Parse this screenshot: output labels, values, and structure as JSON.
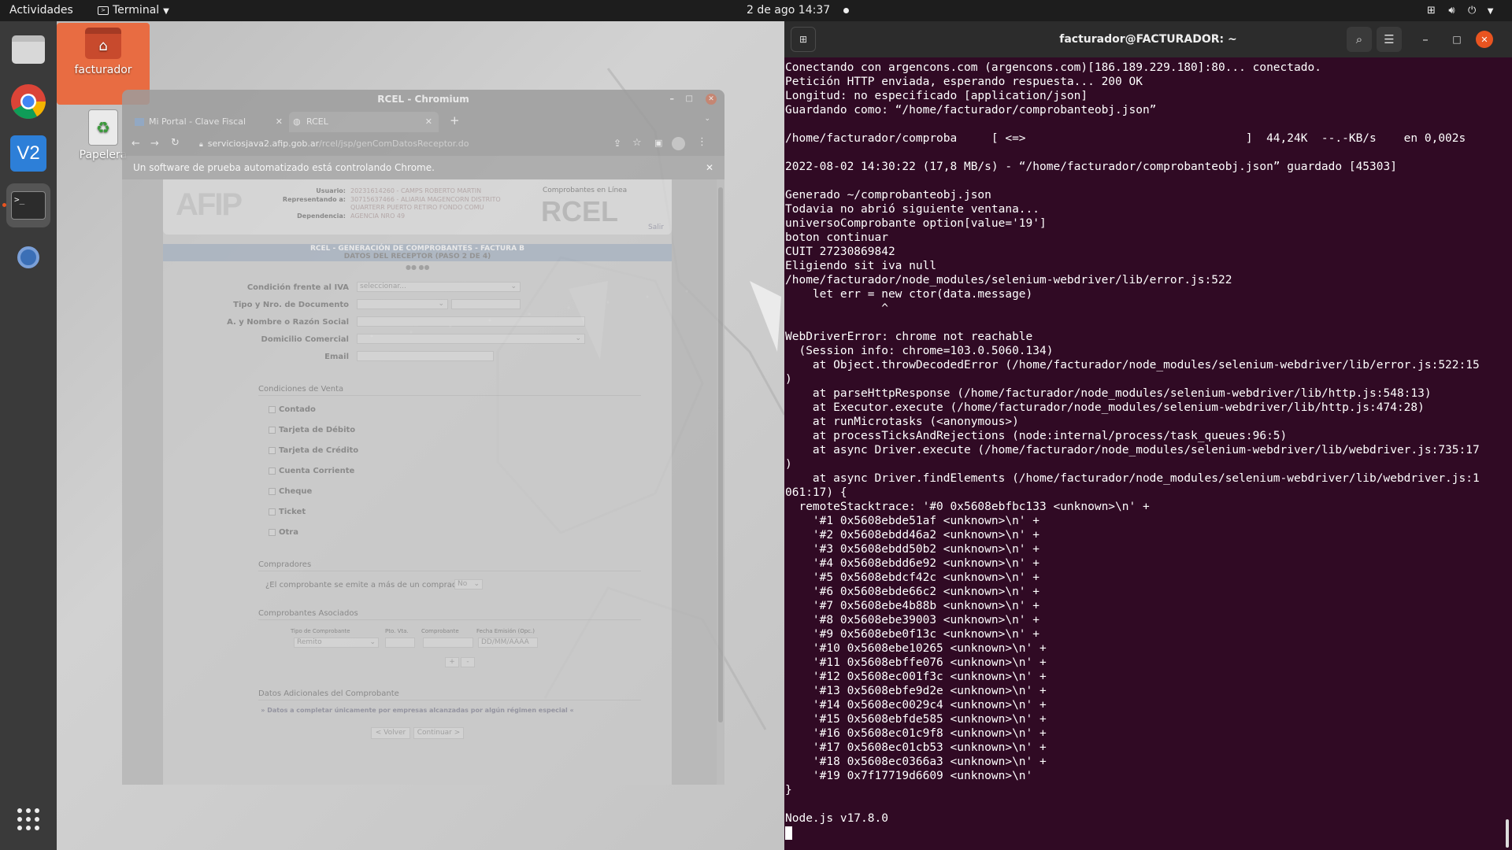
{
  "topbar": {
    "activities": "Actividades",
    "app_name": "Terminal",
    "datetime": "2 de ago  14:37"
  },
  "desktop": {
    "icons": [
      {
        "label": "facturador"
      },
      {
        "label": "Papelera"
      }
    ]
  },
  "chromium": {
    "title": "RCEL - Chromium",
    "tabs": [
      {
        "label": "Mi Portal - Clave Fiscal"
      },
      {
        "label": "RCEL"
      }
    ],
    "url_host": "serviciosjava2.afip.gob.ar",
    "url_path": "/rcel/jsp/genComDatosReceptor.do",
    "infobar": "Un software de prueba automatizado está controlando Chrome.",
    "page": {
      "user_label": "Usuario:",
      "user_value": "20231614260 - CAMPS ROBERTO MARTIN",
      "rep_label": "Representando a:",
      "rep_value": "30715637466 - ALIARIA MAGENCORN DISTRITO",
      "rep_value2": "QUARTERR PUERTO RETIRO FONDO COMU",
      "dep_label": "Dependencia:",
      "dep_value": "AGENCIA NRO 49",
      "online_label": "Comprobantes en Línea",
      "brand": "RCEL",
      "exit": "Salir",
      "section_title": "RCEL - GENERACIÓN DE COMPROBANTES - FACTURA B",
      "section_subtitle": "DATOS DEL RECEPTOR (PASO 2 DE 4)",
      "iva_label": "Condición frente al IVA",
      "iva_value": "seleccionar...",
      "doc_label": "Tipo y Nro. de Documento",
      "name_label": "A. y Nombre o Razón Social",
      "address_label": "Domicilio Comercial",
      "email_label": "Email",
      "sale_conditions": "Condiciones de Venta",
      "conditions": [
        "Contado",
        "Tarjeta de Débito",
        "Tarjeta de Crédito",
        "Cuenta Corriente",
        "Cheque",
        "Ticket",
        "Otra"
      ],
      "buyers_title": "Compradores",
      "buyers_question": "¿El comprobante se emite a más de un comprador?",
      "buyers_value": "No",
      "assoc_title": "Comprobantes Asociados",
      "assoc_headers": [
        "Tipo de Comprobante",
        "Pto. Vta.",
        "Comprobante",
        "Fecha Emisión (Opc.)"
      ],
      "assoc_type": "Remito",
      "assoc_date_placeholder": "DD/MM/AAAA",
      "add_btn": "+",
      "remove_btn": "-",
      "extra_title": "Datos Adicionales del Comprobante",
      "extra_note": "» Datos a completar únicamente por empresas alcanzadas por algún régimen especial «",
      "back_btn": "< Volver",
      "continue_btn": "Continuar >"
    }
  },
  "terminal": {
    "title": "facturador@FACTURADOR: ~",
    "output": "Conectando con argencons.com (argencons.com)[186.189.229.180]:80... conectado.\nPetición HTTP enviada, esperando respuesta... 200 OK\nLongitud: no especificado [application/json]\nGuardando como: “/home/facturador/comprobanteobj.json”\n\n/home/facturador/comproba     [ <=>                                ]  44,24K  --.-KB/s    en 0,002s\n\n2022-08-02 14:30:22 (17,8 MB/s) - “/home/facturador/comprobanteobj.json” guardado [45303]\n\nGenerado ~/comprobanteobj.json\nTodavia no abrió siguiente ventana...\nuniversoComprobante option[value='19']\nboton continuar\nCUIT 27230869842\nEligiendo sit iva null\n/home/facturador/node_modules/selenium-webdriver/lib/error.js:522\n    let err = new ctor(data.message)\n              ^\n\nWebDriverError: chrome not reachable\n  (Session info: chrome=103.0.5060.134)\n    at Object.throwDecodedError (/home/facturador/node_modules/selenium-webdriver/lib/error.js:522:15\n)\n    at parseHttpResponse (/home/facturador/node_modules/selenium-webdriver/lib/http.js:548:13)\n    at Executor.execute (/home/facturador/node_modules/selenium-webdriver/lib/http.js:474:28)\n    at runMicrotasks (<anonymous>)\n    at processTicksAndRejections (node:internal/process/task_queues:96:5)\n    at async Driver.execute (/home/facturador/node_modules/selenium-webdriver/lib/webdriver.js:735:17\n)\n    at async Driver.findElements (/home/facturador/node_modules/selenium-webdriver/lib/webdriver.js:1\n061:17) {\n  remoteStacktrace: '#0 0x5608ebfbc133 <unknown>\\n' +\n    '#1 0x5608ebde51af <unknown>\\n' +\n    '#2 0x5608ebdd46a2 <unknown>\\n' +\n    '#3 0x5608ebdd50b2 <unknown>\\n' +\n    '#4 0x5608ebdd6e92 <unknown>\\n' +\n    '#5 0x5608ebdcf42c <unknown>\\n' +\n    '#6 0x5608ebde66c2 <unknown>\\n' +\n    '#7 0x5608ebe4b88b <unknown>\\n' +\n    '#8 0x5608ebe39003 <unknown>\\n' +\n    '#9 0x5608ebe0f13c <unknown>\\n' +\n    '#10 0x5608ebe10265 <unknown>\\n' +\n    '#11 0x5608ebffe076 <unknown>\\n' +\n    '#12 0x5608ec001f3c <unknown>\\n' +\n    '#13 0x5608ebfe9d2e <unknown>\\n' +\n    '#14 0x5608ec0029c4 <unknown>\\n' +\n    '#15 0x5608ebfde585 <unknown>\\n' +\n    '#16 0x5608ec01c9f8 <unknown>\\n' +\n    '#17 0x5608ec01cb53 <unknown>\\n' +\n    '#18 0x5608ec0366a3 <unknown>\\n' +\n    '#19 0x7f17719d6609 <unknown>\\n'\n}\n\nNode.js v17.8.0\n"
  },
  "colors": {
    "terminal_bg": "#300a24",
    "topbar_bg": "#1d1d1d",
    "dock_bg": "#3a3a3a",
    "selected_icon_bg": "#e95420",
    "close_button": "#e95420"
  }
}
